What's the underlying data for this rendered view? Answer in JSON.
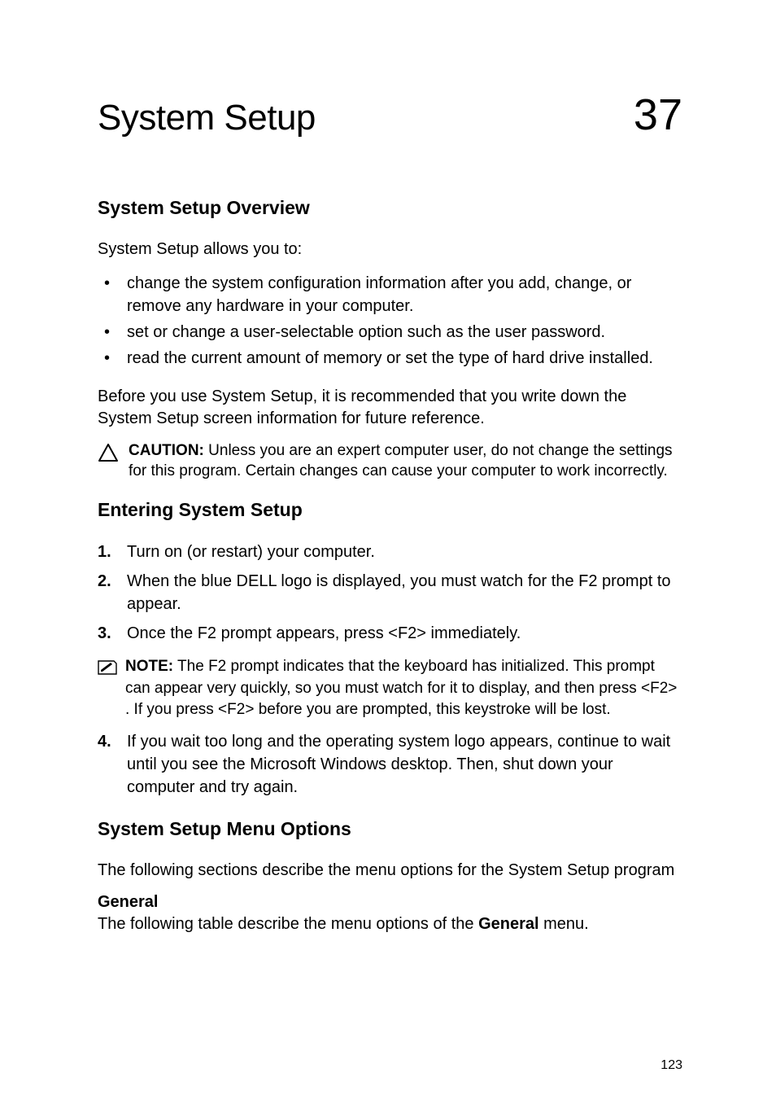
{
  "header": {
    "chapter_title": "System Setup",
    "chapter_number": "37"
  },
  "sections": {
    "overview": {
      "heading": "System Setup Overview",
      "intro": "System Setup allows you to:",
      "bullets": [
        "change the system configuration information after you add, change, or remove any hardware in your computer.",
        "set or change a user-selectable option such as the user password.",
        "read the current amount of memory or set the type of hard drive installed."
      ],
      "before_text": "Before you use System Setup, it is recommended that you write down the System Setup screen information for future reference.",
      "caution_label": "CAUTION:",
      "caution_text": " Unless you are an expert computer user, do not change the settings for this program. Certain changes can cause your computer to work incorrectly."
    },
    "entering": {
      "heading": "Entering System Setup",
      "steps": [
        "Turn on (or restart) your computer.",
        "When the blue DELL logo is displayed, you must watch for the F2 prompt to appear.",
        "Once the F2 prompt appears, press <F2> immediately."
      ],
      "note_label": "NOTE:",
      "note_text": " The F2 prompt indicates that the keyboard has initialized. This prompt can appear very quickly, so you must watch for it to display, and then press <F2> . If you press <F2> before you are prompted, this keystroke will be lost.",
      "step4": "If you wait too long and the operating system logo appears, continue to wait until you see the Microsoft Windows desktop. Then, shut down your computer and try again."
    },
    "menu": {
      "heading": "System Setup Menu Options",
      "intro": "The following sections describe the menu options for the System Setup program",
      "sub_heading": "General",
      "desc_prefix": "The following table describe the menu options of the ",
      "desc_bold": "General",
      "desc_suffix": " menu."
    }
  },
  "page_number": "123"
}
